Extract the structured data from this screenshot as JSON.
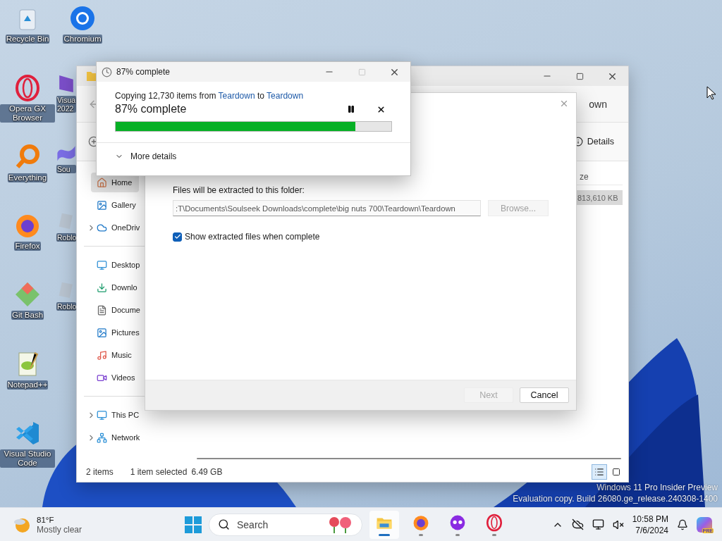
{
  "desktop": {
    "icons_column_1": [
      {
        "label": "Recycle Bin",
        "kind": "bin"
      },
      {
        "label": "Opera GX Browser",
        "kind": "ring"
      },
      {
        "label": "Everything",
        "kind": "magnifier"
      },
      {
        "label": "Firefox",
        "kind": "fox"
      },
      {
        "label": "Git Bash",
        "kind": "diamond"
      },
      {
        "label": "Notepad++",
        "kind": "notepad"
      },
      {
        "label": "Visual Studio Code",
        "kind": "code"
      }
    ],
    "icons_column_2": [
      {
        "label": "Chromium",
        "kind": "globe"
      },
      {
        "label": "Visua 2022",
        "kind": "purple"
      },
      {
        "label": "Sou",
        "kind": "wave"
      },
      {
        "label": "Roblo",
        "kind": "tile"
      },
      {
        "label": "Roblo",
        "kind": "tile"
      }
    ],
    "system_notice": [
      "Windows 11 Pro Insider Preview",
      "Evaluation copy. Build 26080.ge_release.240308-1400"
    ]
  },
  "explorer": {
    "address_fragment": "own",
    "details_button": "Details",
    "column_fragment": "ze",
    "cell": {
      "text": "813,610 KB",
      "selected": true
    },
    "sidebar": {
      "sections": [
        {
          "items": [
            {
              "label": "Home",
              "kind": "home",
              "selected": true,
              "has_children": false
            },
            {
              "label": "Gallery",
              "kind": "gallery",
              "selected": false,
              "has_children": false
            },
            {
              "label": "OneDriv",
              "kind": "cloud",
              "selected": false,
              "has_children": true
            }
          ]
        },
        {
          "items": [
            {
              "label": "Desktop",
              "kind": "desktop",
              "selected": false,
              "has_children": false
            },
            {
              "label": "Downlo",
              "kind": "download",
              "selected": false,
              "has_children": false
            },
            {
              "label": "Docume",
              "kind": "document",
              "selected": false,
              "has_children": false
            },
            {
              "label": "Pictures",
              "kind": "picture",
              "selected": false,
              "has_children": false
            },
            {
              "label": "Music",
              "kind": "music",
              "selected": false,
              "has_children": false
            },
            {
              "label": "Videos",
              "kind": "video",
              "selected": false,
              "has_children": false
            }
          ]
        },
        {
          "items": [
            {
              "label": "This PC",
              "kind": "pc",
              "selected": false,
              "has_children": true
            },
            {
              "label": "Network",
              "kind": "network",
              "selected": false,
              "has_children": true
            }
          ]
        }
      ]
    },
    "status_bar": {
      "count": "2 items",
      "selection": "1 item selected",
      "size": "6.49 GB"
    },
    "views": [
      {
        "kind": "details",
        "selected": true
      },
      {
        "kind": "tiles",
        "selected": false
      }
    ]
  },
  "extract_dialog": {
    "label": "Files will be extracted to this folder:",
    "path": {
      "value": ":T\\Documents\\Soulseek Downloads\\complete\\big nuts 700\\Teardown\\Teardown"
    },
    "browse": {
      "label": "Browse...",
      "disabled": true
    },
    "checkbox": {
      "label": "Show extracted files when complete",
      "checked": true
    },
    "buttons": [
      {
        "label": "Next",
        "disabled": true
      },
      {
        "label": "Cancel",
        "disabled": false
      }
    ]
  },
  "copy_dialog": {
    "title": "87% complete",
    "message": [
      {
        "kind": "text",
        "text": "Copying 12,730 items from "
      },
      {
        "kind": "link",
        "text": "Teardown"
      },
      {
        "kind": "text",
        "text": " to "
      },
      {
        "kind": "link",
        "text": "Teardown"
      }
    ],
    "heading": "87% complete",
    "progress": {
      "level": 0.87
    },
    "more_details": {
      "label": "More details",
      "expanded": false
    }
  },
  "taskbar": {
    "weather": {
      "temperature": "81°F",
      "condition": "Mostly clear"
    },
    "search": {
      "placeholder": "Search"
    },
    "apps": [
      {
        "kind": "folder",
        "selected": true
      },
      {
        "kind": "fox",
        "selected": false
      },
      {
        "kind": "mask",
        "selected": false
      },
      {
        "kind": "ring",
        "selected": false
      }
    ],
    "time": "10:58 PM",
    "date": "7/6/2024",
    "badge": "PRE"
  }
}
